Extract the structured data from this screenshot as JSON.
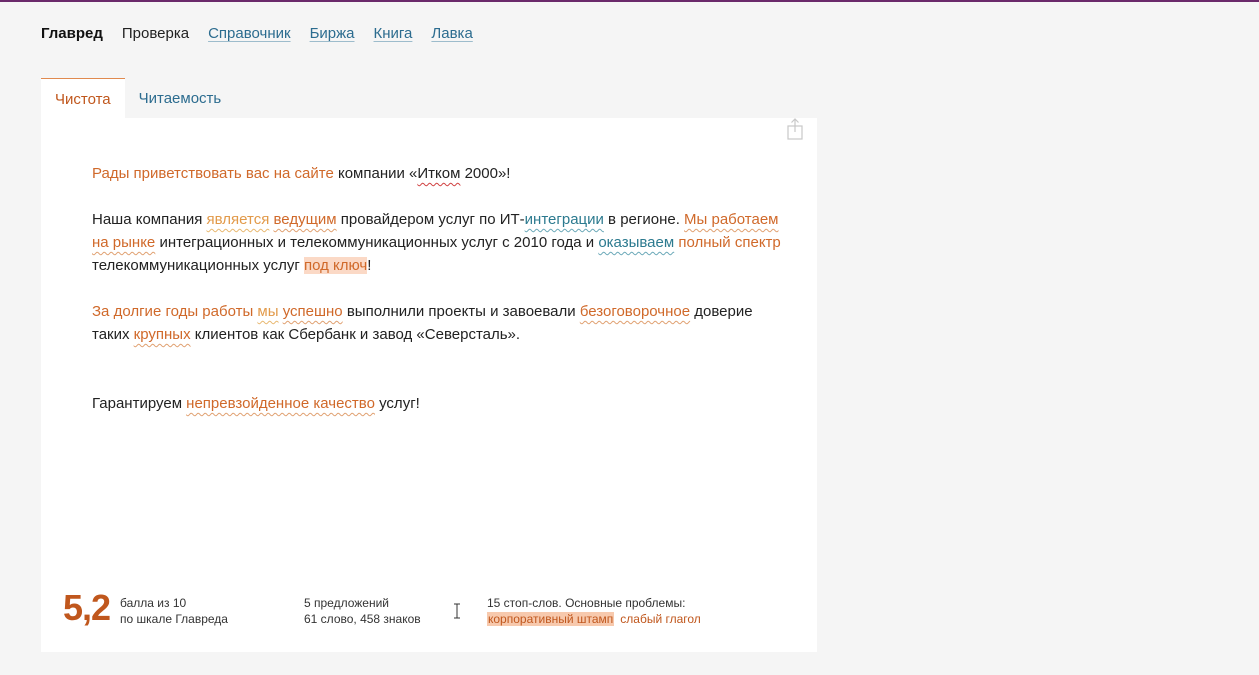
{
  "nav": {
    "items": [
      {
        "label": "Главред"
      },
      {
        "label": "Проверка"
      },
      {
        "label": "Справочник"
      },
      {
        "label": "Биржа"
      },
      {
        "label": "Книга"
      },
      {
        "label": "Лавка"
      }
    ]
  },
  "tabs": [
    {
      "label": "Чистота"
    },
    {
      "label": "Читаемость"
    }
  ],
  "text": {
    "p1": [
      "Рады приветствовать вас на сайте",
      " компании «",
      "Итком",
      " 2000»!"
    ],
    "p2": [
      "Наша компания ",
      "является",
      " ",
      "ведущим",
      " провайдером услуг по ИТ-",
      "интеграции",
      " в регионе. ",
      "Мы работаем на рынке",
      " интеграционных и телекоммуникационных услуг с 2010 года и ",
      "оказываем",
      " ",
      "полный спектр",
      " телекоммуникационных услуг ",
      "под ключ",
      "!"
    ],
    "p3": [
      "За долгие годы работы",
      " ",
      "мы",
      " ",
      "успешно",
      " выполнили проекты и завоевали ",
      "безоговорочное",
      " доверие таких ",
      "крупных",
      " клиентов как Сбербанк и завод «Северсталь»."
    ],
    "p4": [
      "Гарантируем ",
      "непревзойденное качество",
      " услуг!"
    ]
  },
  "stats": {
    "score": "5,2",
    "score_line1": "балла из 10",
    "score_line2": "по шкале Главреда",
    "sentences": "5 предложений",
    "words": "61 слово, 458 знаков",
    "stopwords": "15 стоп-слов. Основные проблемы:",
    "problem1": "корпоративный штамп",
    "problem2": "слабый глагол"
  },
  "icons": {
    "share": "share-icon"
  },
  "colors": {
    "accent": "#c0571d",
    "link": "#2c6c8f",
    "highlight": "#fbd9c6"
  }
}
